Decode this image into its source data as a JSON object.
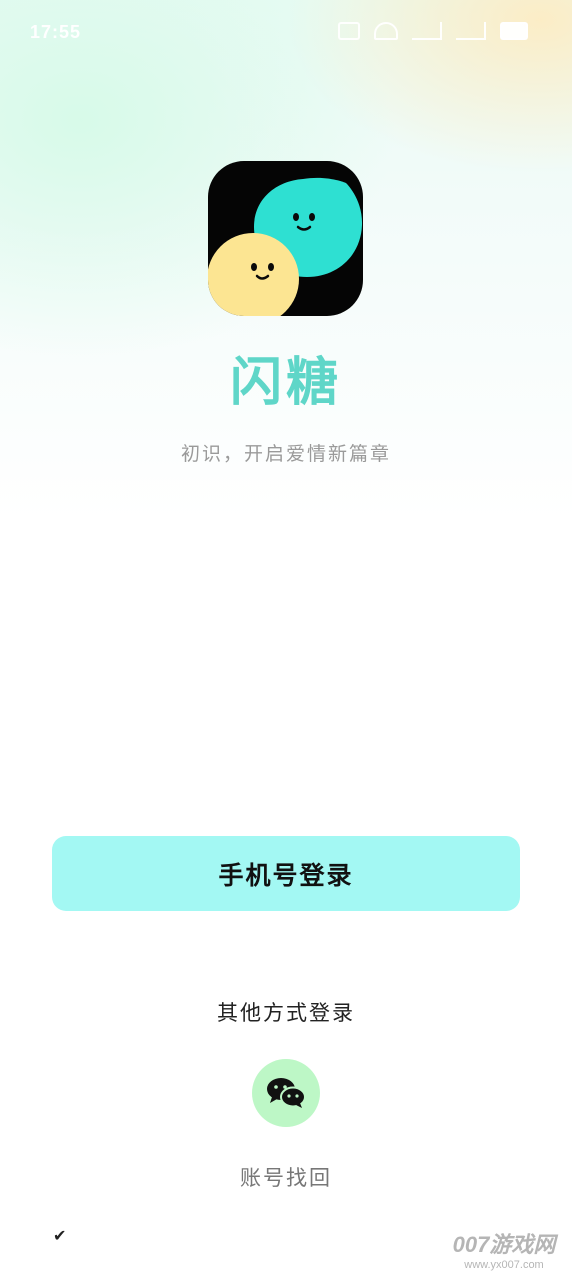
{
  "status_bar": {
    "time": "17:55"
  },
  "app": {
    "name": "闪糖",
    "tagline": "初识，开启爱情新篇章",
    "logo_icon": "two-smiling-bubbles-logo",
    "colors": {
      "brand_text": "#5fd6c8",
      "logo_teal": "#2ee0d2",
      "logo_yellow": "#fce592"
    }
  },
  "login": {
    "phone_button_label": "手机号登录",
    "phone_button_color": "#a3f8f3",
    "other_methods_label": "其他方式登录",
    "wechat_icon": "wechat-icon",
    "wechat_color": "#bdf7c6",
    "account_recover_label": "账号找回",
    "agreement_checkmark": "✔"
  },
  "watermark": {
    "brand": "007游戏网",
    "url": "www.yx007.com"
  }
}
